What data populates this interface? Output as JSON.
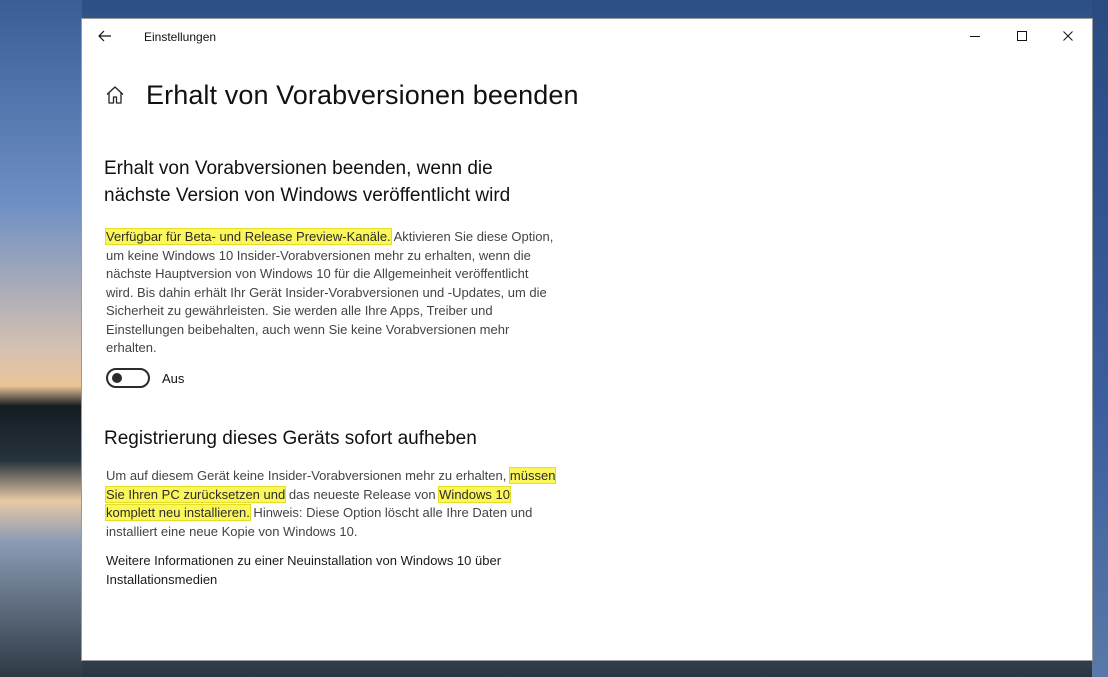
{
  "window": {
    "app_title": "Einstellungen",
    "icons": {
      "back": "back-arrow-icon",
      "minimize": "minimize-icon",
      "maximize": "maximize-icon",
      "close": "close-icon",
      "home": "home-icon"
    }
  },
  "page": {
    "title": "Erhalt von Vorabversionen beenden"
  },
  "section1": {
    "title": "Erhalt von Vorabversionen beenden, wenn die nächste Version von Windows veröffentlicht wird",
    "highlight": "Verfügbar für Beta- und Release Preview-Kanäle.",
    "body": " Aktivieren Sie diese Option, um keine Windows 10 Insider-Vorabversionen mehr zu erhalten, wenn die nächste Hauptversion von Windows 10 für die Allgemeinheit veröffentlicht wird. Bis dahin erhält Ihr Gerät Insider-Vorabversionen und -Updates, um die Sicherheit zu gewährleisten. Sie werden alle Ihre Apps, Treiber und Einstellungen beibehalten, auch wenn Sie keine Vorabversionen mehr erhalten.",
    "toggle_state": "Aus",
    "toggle_on": false
  },
  "section2": {
    "title": "Registrierung dieses Geräts sofort aufheben",
    "body_start": "Um auf diesem Gerät keine Insider-Vorabversionen mehr zu erhalten, ",
    "highlight1": "müssen Sie Ihren PC zurücksetzen und",
    "body_mid": " das neueste Release von ",
    "highlight2": "Windows 10 komplett neu installieren.",
    "body_end": " Hinweis: Diese Option löscht alle Ihre Daten und installiert eine neue Kopie von Windows 10.",
    "link": "Weitere Informationen zu einer Neuinstallation von Windows 10 über Installationsmedien"
  },
  "colors": {
    "highlight": "#fbf65a",
    "text_primary": "#111111",
    "text_secondary": "#444444"
  }
}
